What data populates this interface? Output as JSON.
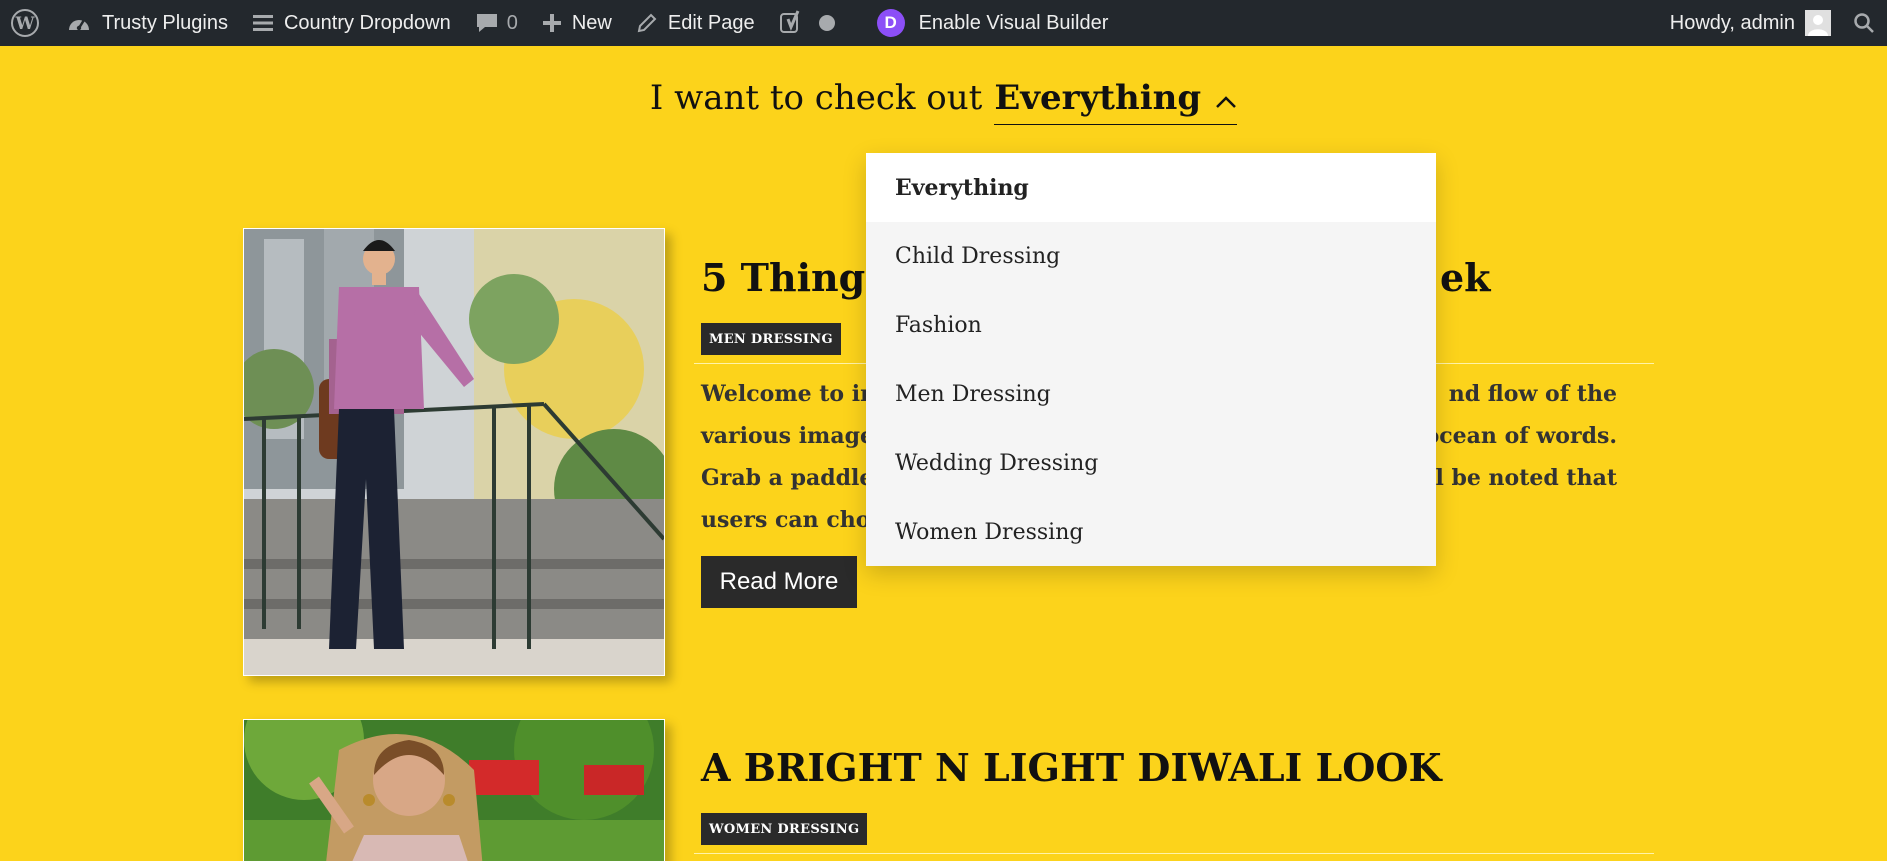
{
  "adminbar": {
    "site_name": "Trusty Plugins",
    "page_name": "Country Dropdown",
    "comments_count": "0",
    "new_label": "New",
    "edit_label": "Edit Page",
    "divi_letter": "D",
    "builder_label": "Enable Visual Builder",
    "howdy": "Howdy, admin",
    "icons": [
      "wordpress-icon",
      "dashboard-icon",
      "menu-icon",
      "comment-icon",
      "plus-icon",
      "pencil-icon",
      "yoast-icon",
      "status-dot-icon",
      "divi-icon",
      "avatar-icon"
    ]
  },
  "filter": {
    "lead_text": "I want to check out",
    "selected": "Everything",
    "options": [
      "Everything",
      "Child Dressing",
      "Fashion",
      "Men Dressing",
      "Wedding Dressing",
      "Women Dressing"
    ]
  },
  "posts": [
    {
      "title_left": "5 Things I",
      "title_right": "ek",
      "category": "MEN DRESSING",
      "excerpt_lines": [
        [
          "Welcome to ima",
          "nd flow of the"
        ],
        [
          "various image p",
          "n ocean of words."
        ],
        [
          "Grab a paddle ar",
          "l be noted that"
        ],
        [
          "users can choos",
          ""
        ]
      ],
      "read_more": "Read More"
    },
    {
      "title": "A BRIGHT N LIGHT DIWALI LOOK",
      "category": "WOMEN DRESSING"
    }
  ],
  "colors": {
    "page_bg": "#fcd31b",
    "adminbar_bg": "#23282d",
    "divi_purple": "#8c4ff7",
    "badge_bg": "#2a2a2a"
  }
}
